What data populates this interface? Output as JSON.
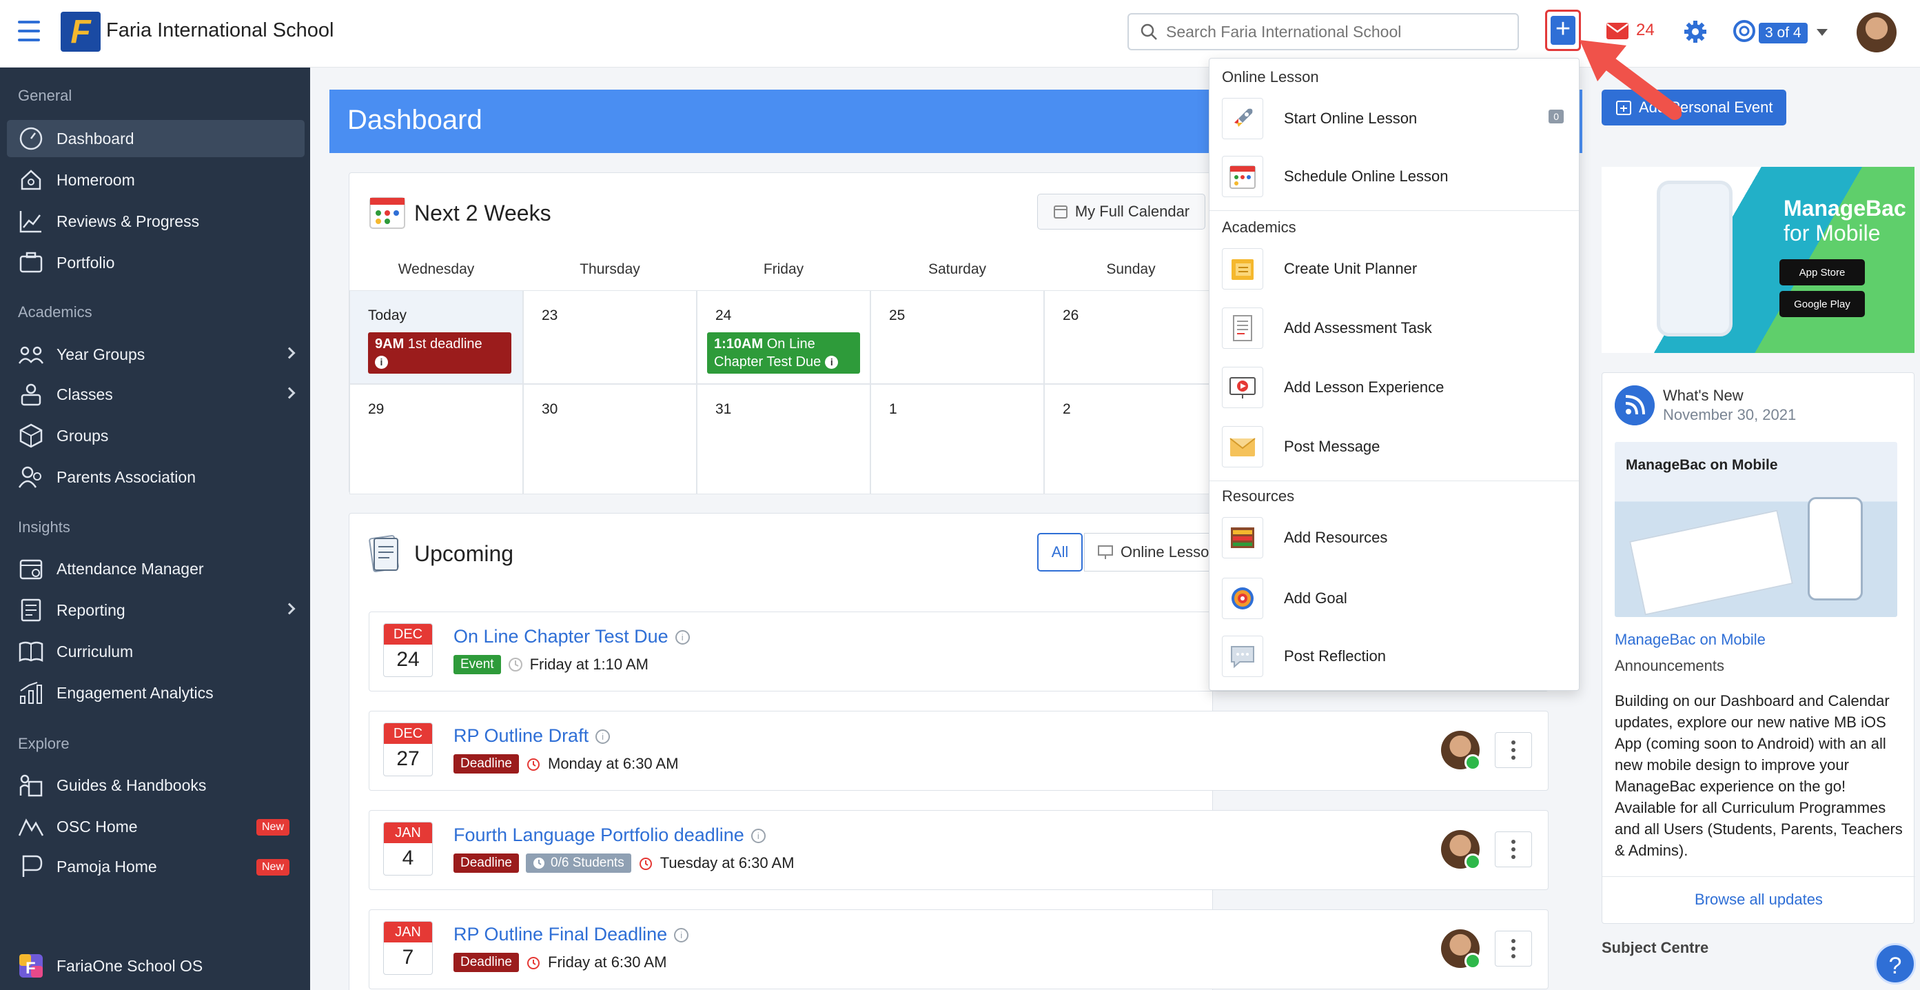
{
  "app": {
    "school_name": "Faria International School",
    "logo_letter": "F"
  },
  "search": {
    "placeholder": "Search Faria International School"
  },
  "topbar": {
    "plus_label": "+",
    "mail_count": "24",
    "profile_count": "3 of 4"
  },
  "colors": {
    "accent": "#2f6fd6",
    "sidebar": "#273446",
    "deadline": "#9b1c1c",
    "event": "#2e9b3a",
    "alert": "#e53935"
  },
  "sidebar": {
    "sections": [
      {
        "label": "General",
        "items": [
          {
            "label": "Dashboard",
            "icon": "dashboard-icon",
            "active": true
          },
          {
            "label": "Homeroom",
            "icon": "homeroom-icon"
          },
          {
            "label": "Reviews & Progress",
            "icon": "chart-line-icon"
          },
          {
            "label": "Portfolio",
            "icon": "portfolio-icon"
          }
        ]
      },
      {
        "label": "Academics",
        "items": [
          {
            "label": "Year Groups",
            "icon": "year-groups-icon",
            "chevron": true
          },
          {
            "label": "Classes",
            "icon": "classes-icon",
            "chevron": true
          },
          {
            "label": "Groups",
            "icon": "groups-icon"
          },
          {
            "label": "Parents Association",
            "icon": "parents-icon"
          }
        ]
      },
      {
        "label": "Insights",
        "items": [
          {
            "label": "Attendance Manager",
            "icon": "attendance-icon"
          },
          {
            "label": "Reporting",
            "icon": "reporting-icon",
            "chevron": true
          },
          {
            "label": "Curriculum",
            "icon": "curriculum-icon"
          },
          {
            "label": "Engagement Analytics",
            "icon": "analytics-icon"
          }
        ]
      },
      {
        "label": "Explore",
        "items": [
          {
            "label": "Guides & Handbooks",
            "icon": "guides-icon"
          },
          {
            "label": "OSC Home",
            "icon": "osc-icon",
            "badge": "New"
          },
          {
            "label": "Pamoja Home",
            "icon": "pamoja-icon",
            "badge": "New"
          }
        ]
      }
    ],
    "footer": "FariaOne School OS"
  },
  "dashboard": {
    "title": "Dashboard"
  },
  "calendar": {
    "title": "Next 2 Weeks",
    "full_calendar_label": "My Full Calendar",
    "day_headers": [
      "Wednesday",
      "Thursday",
      "Friday",
      "Saturday",
      "Sunday"
    ],
    "week1": [
      "Today",
      "23",
      "24",
      "25",
      "26"
    ],
    "week2": [
      "29",
      "30",
      "31",
      "1",
      "2"
    ],
    "events": [
      {
        "text": "9AM 1st deadline",
        "time": "9AM",
        "label": "1st deadline"
      },
      {
        "text": "1:10AM On Line Chapter Test Due",
        "time": "1:10AM",
        "label1": "On Line",
        "label2": "Chapter Test Due"
      }
    ]
  },
  "upcoming": {
    "title": "Upcoming",
    "filter_all": "All",
    "filter_online": "Online Lesso",
    "items": [
      {
        "month": "DEC",
        "day": "24",
        "title": "On Line Chapter Test Due",
        "tag": "Event",
        "when": "Friday at 1:10 AM"
      },
      {
        "month": "DEC",
        "day": "27",
        "title": "RP Outline Draft",
        "tag": "Deadline",
        "when": "Monday at 6:30 AM"
      },
      {
        "month": "JAN",
        "day": "4",
        "title": "Fourth Language Portfolio deadline",
        "tag": "Deadline",
        "students": "0/6 Students",
        "when": "Tuesday at 6:30 AM"
      },
      {
        "month": "JAN",
        "day": "7",
        "title": "RP Outline Final Deadline",
        "tag": "Deadline",
        "when": "Friday at 6:30 AM"
      }
    ]
  },
  "right": {
    "add_personal_event": "Add Personal Event",
    "promo": {
      "title1": "ManageBac",
      "title2": "for Mobile",
      "app_store": "App Store",
      "google_play": "Google Play"
    },
    "whats_new": {
      "title": "What's New",
      "date": "November 30, 2021",
      "image_title": "ManageBac on Mobile",
      "link": "ManageBac on Mobile",
      "subtitle": "Announcements",
      "body": "Building on our Dashboard and Calendar updates, explore our new native MB iOS App (coming soon to Android) with an all new mobile design to improve your ManageBac experience on the go! Available for all Curriculum Programmes and all Users (Students, Parents, Teachers & Admins).",
      "browse": "Browse all updates"
    },
    "subject_centre": "Subject Centre"
  },
  "dropdown": {
    "sections": [
      {
        "label": "Online Lesson",
        "items": [
          {
            "label": "Start Online Lesson",
            "icon": "rocket-icon",
            "badge": "0"
          },
          {
            "label": "Schedule Online Lesson",
            "icon": "calendar-schedule-icon"
          }
        ]
      },
      {
        "label": "Academics",
        "items": [
          {
            "label": "Create Unit Planner",
            "icon": "unit-planner-icon"
          },
          {
            "label": "Add Assessment Task",
            "icon": "assessment-icon"
          },
          {
            "label": "Add Lesson Experience",
            "icon": "lesson-video-icon"
          },
          {
            "label": "Post Message",
            "icon": "envelope-icon"
          }
        ]
      },
      {
        "label": "Resources",
        "items": [
          {
            "label": "Add Resources",
            "icon": "resources-icon"
          },
          {
            "label": "Add Goal",
            "icon": "goal-icon"
          },
          {
            "label": "Post Reflection",
            "icon": "reflection-icon"
          }
        ]
      }
    ]
  }
}
